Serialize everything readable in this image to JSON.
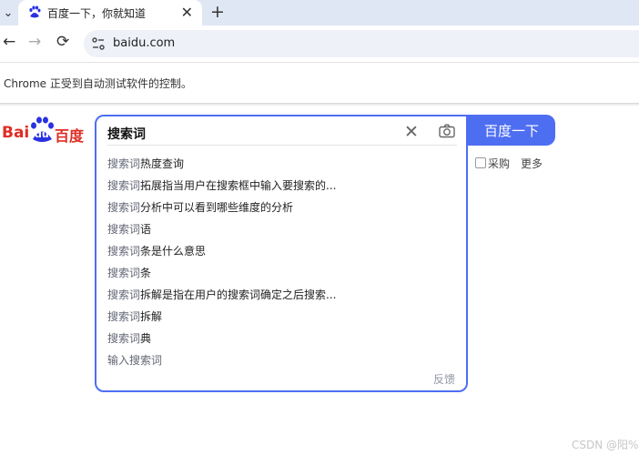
{
  "browser": {
    "tab": {
      "title": "百度一下，你就知道",
      "close": "✕"
    },
    "new_tab": "+",
    "tab_menu": "⌄",
    "url": "baidu.com",
    "back": "←",
    "forward": "→",
    "reload": "⟳",
    "infobar": "Chrome 正受到自动测试软件的控制。"
  },
  "logo": {
    "bai": "Bai",
    "du": "du",
    "cn": "百度",
    "brand_red": "#de2d24",
    "paw_blue": "#2932e1"
  },
  "search": {
    "query": "搜索词",
    "clear": "✕",
    "button": "百度一下",
    "accent": "#4e6ef2",
    "suggestions": [
      {
        "key": "搜索词",
        "rest": "热度查询"
      },
      {
        "key": "搜索词",
        "rest": "拓展指当用户在搜索框中输入要搜索的..."
      },
      {
        "key": "搜索词",
        "rest": "分析中可以看到哪些维度的分析"
      },
      {
        "key": "搜索词",
        "rest": "语"
      },
      {
        "key": "搜索词",
        "rest": "条是什么意思"
      },
      {
        "key": "搜索词",
        "rest": "条"
      },
      {
        "key": "搜索词",
        "rest": "拆解是指在用户的搜索词确定之后搜索..."
      },
      {
        "key": "搜索词",
        "rest": "拆解"
      },
      {
        "key": "搜索词",
        "rest": "典"
      },
      {
        "key": "输入搜索词",
        "rest": ""
      }
    ],
    "feedback": "反馈"
  },
  "links": {
    "caigou": "采购",
    "more": "更多"
  },
  "watermark": "CSDN @阳%"
}
